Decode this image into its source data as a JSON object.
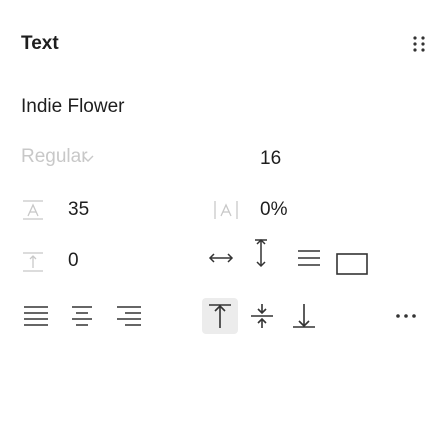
{
  "section": {
    "title": "Text",
    "more_icon": "grid-dots-icon"
  },
  "font": {
    "family": "Indie Flower",
    "style": "Regular",
    "size": "16"
  },
  "metrics": {
    "line_height": "35",
    "letter_spacing": "0%",
    "paragraph_spacing": "0"
  },
  "colors": {
    "text": "#1e1e1e",
    "muted": "#c8c8c8",
    "icon": "#333333",
    "selected_bg": "#ececec"
  }
}
